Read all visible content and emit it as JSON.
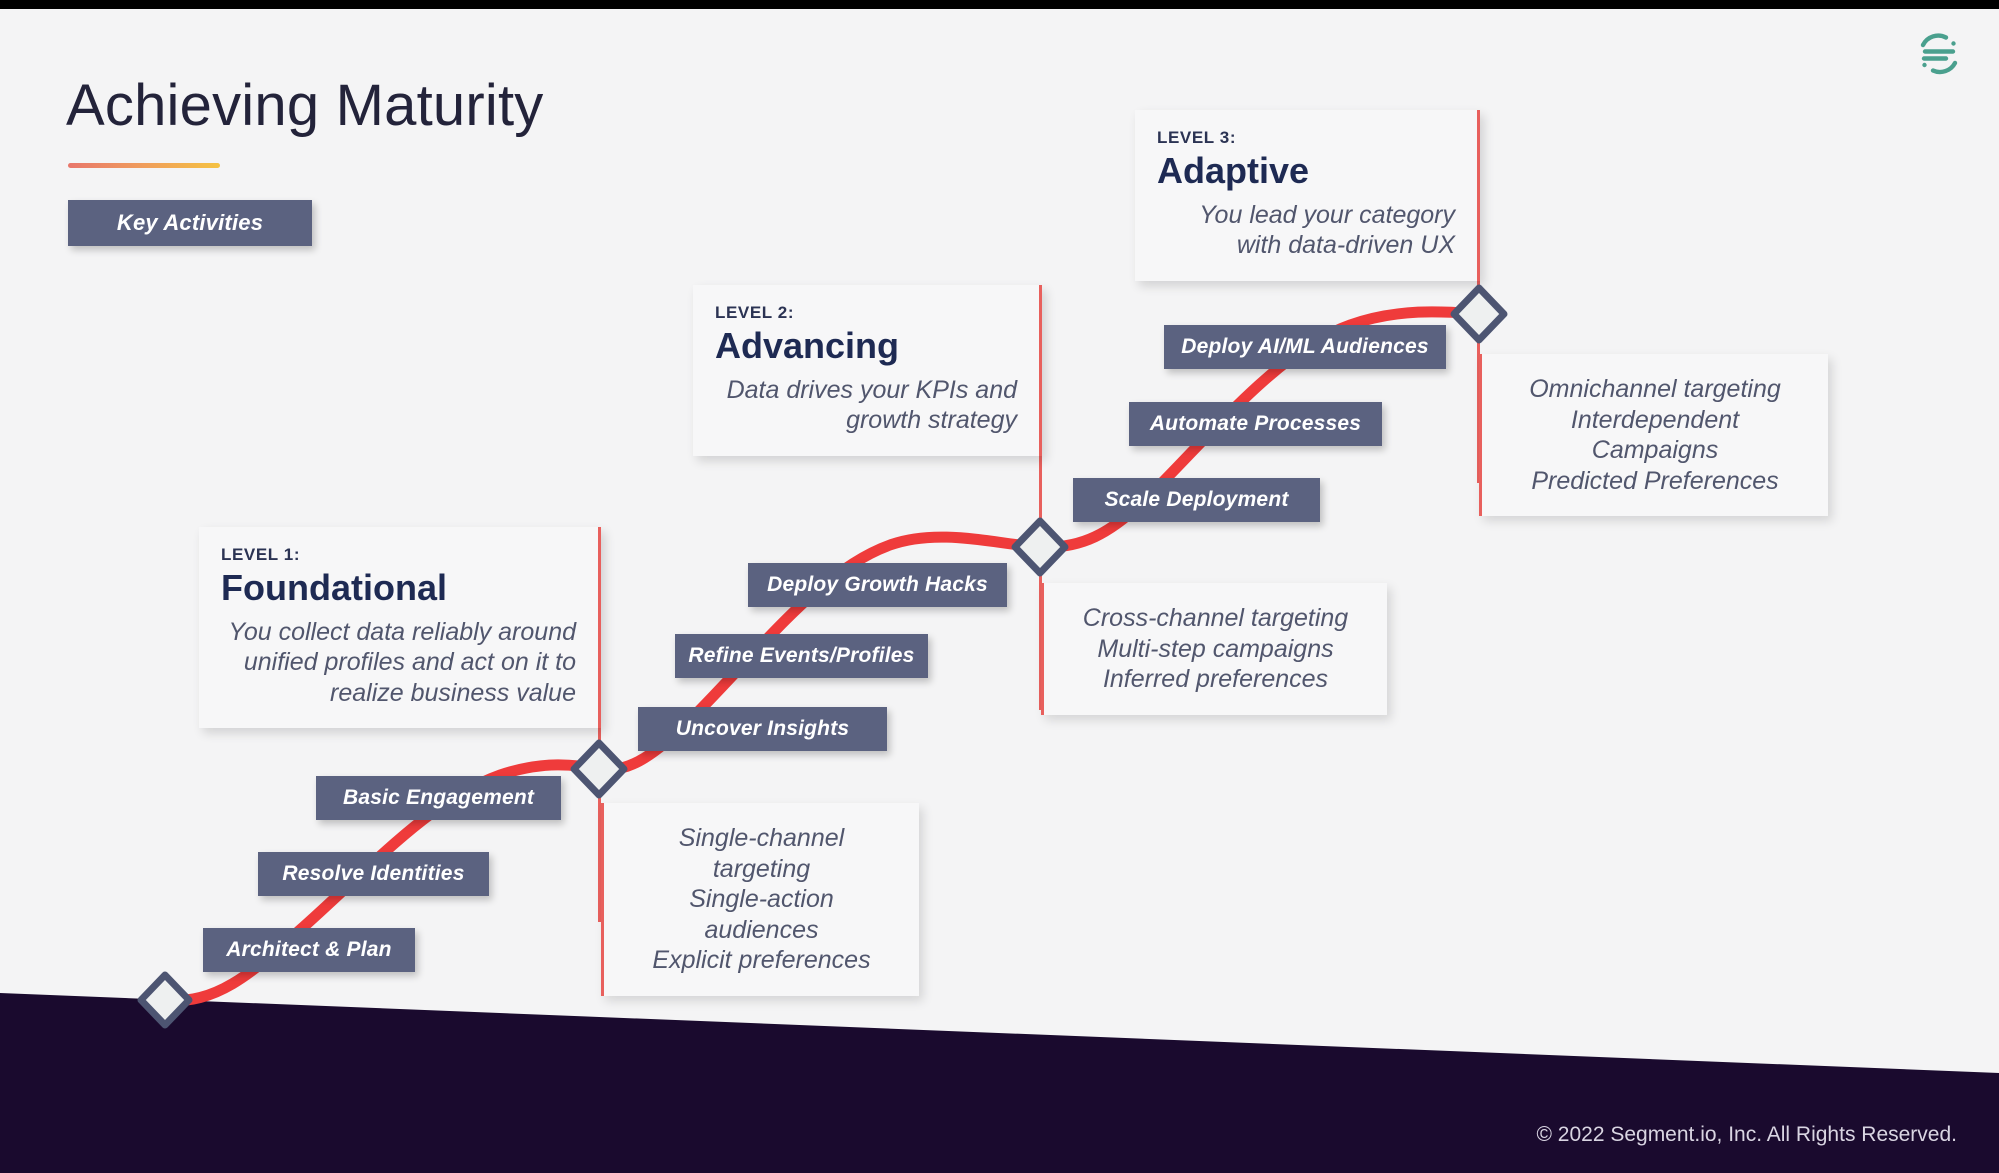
{
  "slide": {
    "title": "Achieving Maturity",
    "footer": "© 2022 Segment.io, Inc. All Rights Reserved.",
    "logo_name": "segment-logo",
    "accent_red": "#e8605d",
    "accent_slate": "#5b6280",
    "accent_navy": "#1e2a53",
    "band_dark": "#1a0a2e",
    "background": "#f4f4f5",
    "rule_gradient_from": "#e8766b",
    "rule_gradient_to": "#f5c242"
  },
  "legend": {
    "key_activities_label": "Key Activities"
  },
  "levels": [
    {
      "eyebrow": "LEVEL 1:",
      "name": "Foundational",
      "description": "You collect data reliably around unified profiles and act on it to realize business value"
    },
    {
      "eyebrow": "LEVEL 2:",
      "name": "Advancing",
      "description": "Data drives your KPIs and growth strategy"
    },
    {
      "eyebrow": "LEVEL 3:",
      "name": "Adaptive",
      "description": "You lead your category with data-driven UX"
    }
  ],
  "activities": [
    {
      "label": "Architect & Plan"
    },
    {
      "label": "Resolve Identities"
    },
    {
      "label": "Basic Engagement"
    },
    {
      "label": "Uncover Insights"
    },
    {
      "label": "Refine Events/Profiles"
    },
    {
      "label": "Deploy Growth Hacks"
    },
    {
      "label": "Scale Deployment"
    },
    {
      "label": "Automate Processes"
    },
    {
      "label": "Deploy AI/ML Audiences"
    }
  ],
  "outcomes": [
    {
      "lines": [
        "Single-channel targeting",
        "Single-action audiences",
        "Explicit preferences"
      ]
    },
    {
      "lines": [
        "Cross-channel targeting",
        "Multi-step campaigns",
        "Inferred preferences"
      ]
    },
    {
      "lines": [
        "Omnichannel targeting",
        "Interdependent Campaigns",
        "Predicted Preferences"
      ]
    }
  ],
  "milestones": [
    {
      "name": "milestone-start"
    },
    {
      "name": "milestone-level-1"
    },
    {
      "name": "milestone-level-2"
    },
    {
      "name": "milestone-level-3"
    }
  ]
}
